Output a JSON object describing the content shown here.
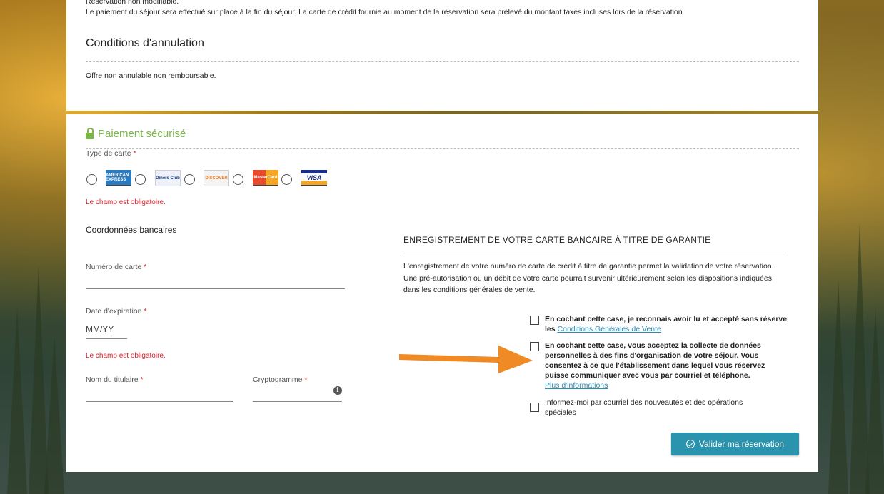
{
  "top_section": {
    "line1": "Réservation non modifiable.",
    "line2": "Le paiement du séjour sera effectué sur place à la fin du séjour. La carte de crédit fournie au moment de la réservation sera prélevé du montant taxes incluses lors de la réservation",
    "cancel_title": "Conditions d'annulation",
    "cancel_text": "Offre non annulable non remboursable."
  },
  "payment": {
    "title": "Paiement sécurisé",
    "card_type_label": "Type de carte",
    "required_mark": "*",
    "card_types": [
      {
        "name": "AMERICAN EXPRESS",
        "color": "#2b7bc0"
      },
      {
        "name": "Diners Club",
        "color": "#1a3c8a"
      },
      {
        "name": "DISCOVER",
        "color": "#f07c1a"
      },
      {
        "name": "MasterCard",
        "color": "#e84a2b"
      },
      {
        "name": "VISA",
        "color": "#1a2f8a"
      }
    ],
    "card_type_error": "Le champ est obligatoire.",
    "bank_section_title": "Coordonnées bancaires",
    "card_number_label": "Numéro de carte",
    "card_number_value": "",
    "expiry_label": "Date d'expiration",
    "expiry_placeholder": "MM/YY",
    "expiry_error": "Le champ est obligatoire.",
    "holder_label": "Nom du titulaire",
    "holder_value": "",
    "cvv_label": "Cryptogramme",
    "cvv_value": ""
  },
  "guarantee": {
    "title": "ENREGISTREMENT DE VOTRE CARTE BANCAIRE À TITRE DE GARANTIE",
    "text": "L'enregistrement de votre numéro de carte de crédit à titre de garantie permet la validation de votre réservation. Une pré-autorisation ou un débit de votre carte pourrait survenir ultérieurement selon les dispositions indiquées dans les conditions générales de vente."
  },
  "consents": {
    "cgv_text": "En cochant cette case, je reconnais avoir lu et accepté sans réserve les",
    "cgv_link": "Conditions Générales de Vente",
    "data_text": "En cochant cette case, vous acceptez la collecte de données personnelles à des fins d'organisation de votre séjour. Vous consentez à ce que l'établissement dans lequel vous réservez puisse communiquer avec vous par courriel et téléphone.",
    "data_link": "Plus d'informations",
    "newsletter_text": "Informez-moi par courriel des nouveautés et des opérations spéciales"
  },
  "submit_label": "Valider ma réservation",
  "colors": {
    "accent_green": "#7ab648",
    "error_red": "#d9232e",
    "button_teal": "#2a93ad",
    "arrow_orange": "#f08a24"
  }
}
